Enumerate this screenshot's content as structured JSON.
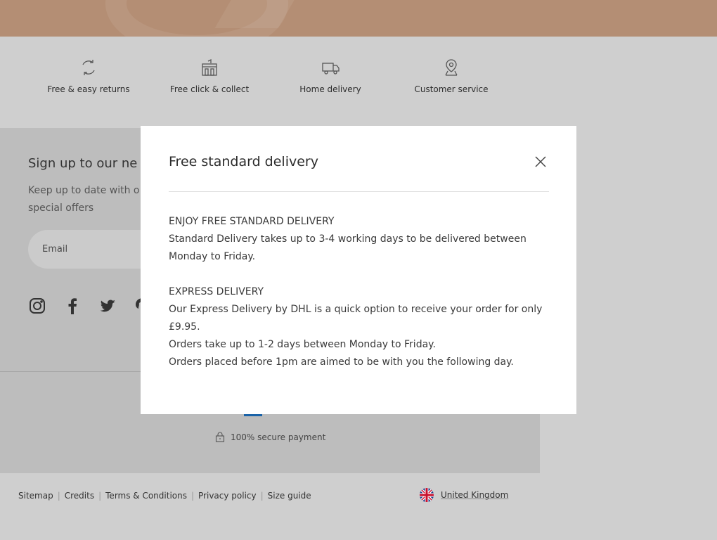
{
  "services": [
    {
      "label": "Free & easy returns",
      "icon": "refresh-icon"
    },
    {
      "label": "Free click & collect",
      "icon": "store-icon"
    },
    {
      "label": "Home delivery",
      "icon": "truck-icon"
    },
    {
      "label": "Customer service",
      "icon": "location-pin-icon"
    }
  ],
  "newsletter": {
    "title": "Sign up to our ne",
    "text_line1": "Keep up to date with o",
    "text_line2": "special offers",
    "email_placeholder": "Email"
  },
  "social": [
    "instagram-icon",
    "facebook-icon",
    "twitter-icon",
    "pinterest-icon"
  ],
  "payment": {
    "secure_text": "100% secure payment"
  },
  "footer_links": [
    "Sitemap",
    "Credits",
    "Terms & Conditions",
    "Privacy policy",
    "Size guide"
  ],
  "country": {
    "label": "United Kingdom",
    "icon": "uk-flag-icon"
  },
  "modal": {
    "title": "Free standard delivery",
    "paragraphs": [
      "ENJOY FREE STANDARD DELIVERY",
      "Standard Delivery takes up to 3-4 working days to be delivered between Monday to Friday.",
      "",
      "EXPRESS DELIVERY",
      "Our Express Delivery by DHL is a quick option to receive your order for only £9.95.",
      "Orders take up to 1-2 days between Monday to Friday.",
      "Orders placed before 1pm are aimed to be with you the following day."
    ]
  },
  "colors": {
    "hero": "#b48e74",
    "overlay_bg": "#cfcfcf",
    "accent_blue": "#1a63a8"
  }
}
